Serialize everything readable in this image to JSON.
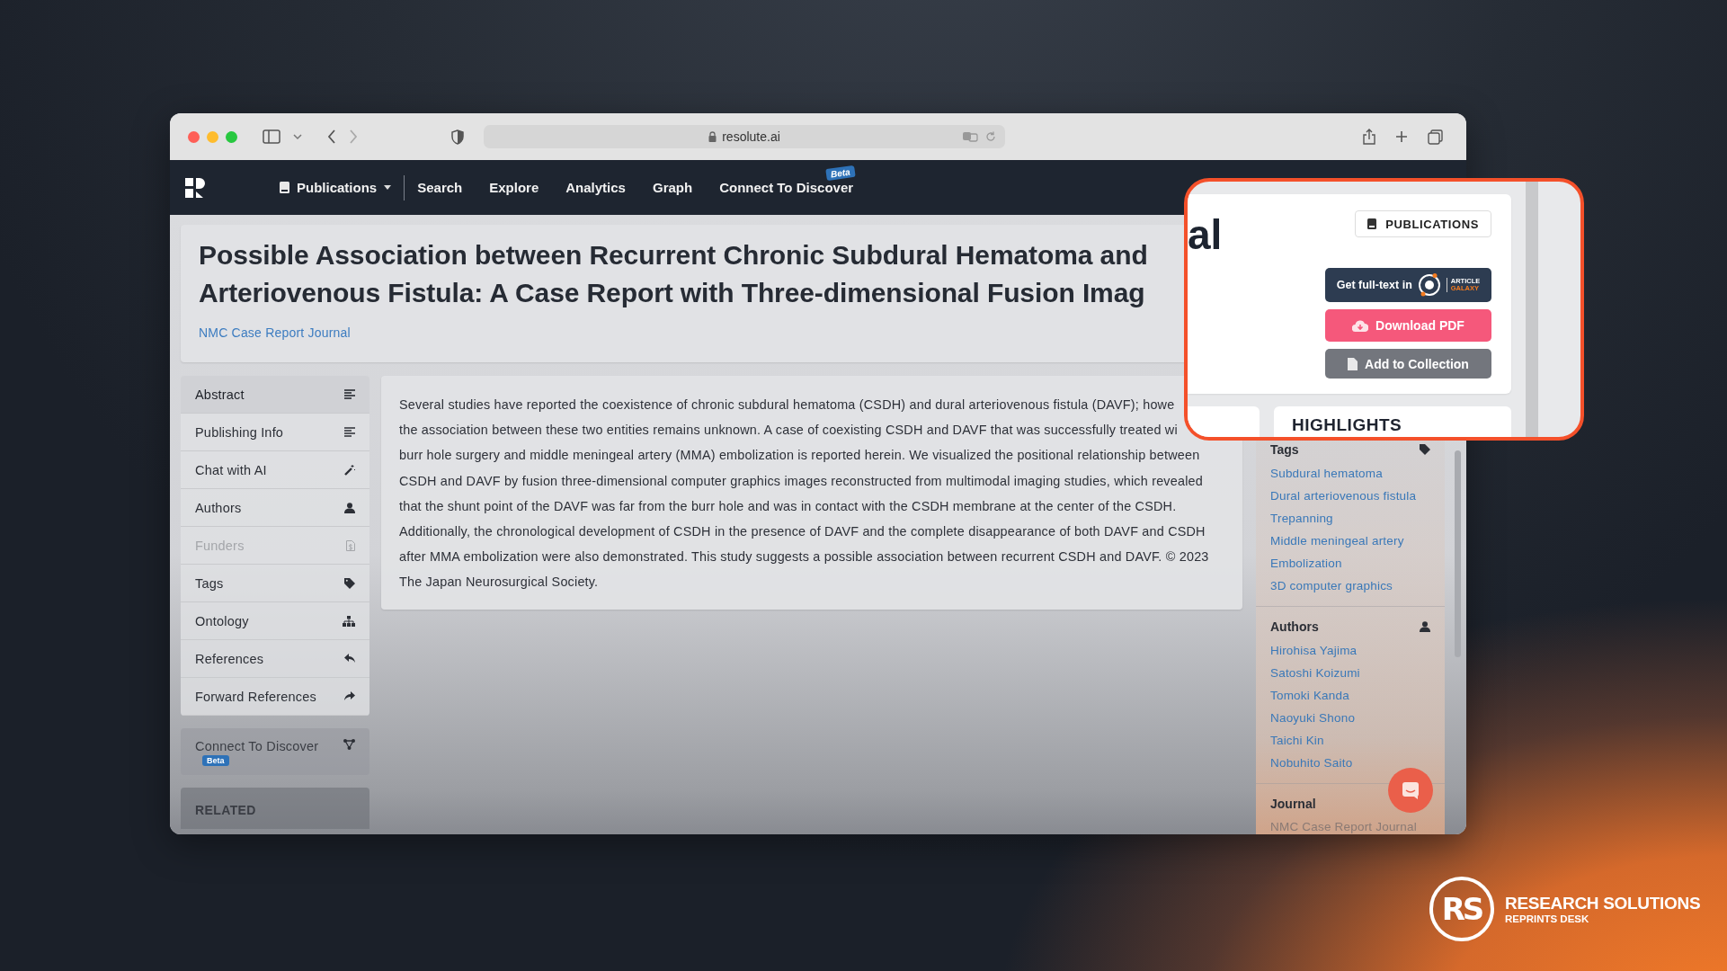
{
  "browser": {
    "url": "resolute.ai"
  },
  "nav": {
    "menu": "Publications",
    "links": [
      {
        "label": "Search"
      },
      {
        "label": "Explore"
      },
      {
        "label": "Analytics"
      },
      {
        "label": "Graph"
      },
      {
        "label": "Connect To Discover",
        "badge": "Beta"
      }
    ]
  },
  "article": {
    "title_lines": [
      "Possible Association between Recurrent Chronic Subdural Hematoma and",
      "Arteriovenous Fistula: A Case Report with Three-dimensional Fusion Imag"
    ],
    "journal": "NMC Case Report Journal"
  },
  "sidebar": {
    "items": [
      {
        "label": "Abstract",
        "selected": true,
        "disabled": false
      },
      {
        "label": "Publishing Info",
        "selected": false,
        "disabled": false
      },
      {
        "label": "Chat with AI",
        "selected": false,
        "disabled": false
      },
      {
        "label": "Authors",
        "selected": false,
        "disabled": false
      },
      {
        "label": "Funders",
        "selected": false,
        "disabled": true
      },
      {
        "label": "Tags",
        "selected": false,
        "disabled": false
      },
      {
        "label": "Ontology",
        "selected": false,
        "disabled": false
      },
      {
        "label": "References",
        "selected": false,
        "disabled": false
      },
      {
        "label": "Forward References",
        "selected": false,
        "disabled": false
      }
    ],
    "connect": {
      "label": "Connect To Discover",
      "badge": "Beta"
    },
    "related": "RELATED"
  },
  "abstract": {
    "lines": [
      "Several studies have reported the coexistence of chronic subdural hematoma (CSDH) and dural arteriovenous fistula (DAVF); howe",
      "the association between these two entities remains unknown. A case of coexisting CSDH and DAVF that was successfully treated wi",
      "burr hole surgery and middle meningeal artery (MMA) embolization is reported herein. We visualized the positional relationship between",
      "CSDH and DAVF by fusion three-dimensional computer graphics images reconstructed from multimodal imaging studies, which revealed",
      "that the shunt point of the DAVF was far from the burr hole and was in contact with the CSDH membrane at the center of the CSDH.",
      "Additionally, the chronological development of CSDH in the presence of DAVF and the complete disappearance of both DAVF and CSDH",
      "after MMA embolization were also demonstrated. This study suggests a possible association between recurrent CSDH and DAVF. © 2023",
      "The Japan Neurosurgical Society."
    ]
  },
  "side_panel": {
    "tags": {
      "title": "Tags",
      "items": [
        "Subdural hematoma",
        "Dural arteriovenous fistula",
        "Trepanning",
        "Middle meningeal artery",
        "Embolization",
        "3D computer graphics"
      ]
    },
    "authors": {
      "title": "Authors",
      "items": [
        "Hirohisa Yajima",
        "Satoshi Koizumi",
        "Tomoki Kanda",
        "Naoyuki Shono",
        "Taichi Kin",
        "Nobuhito Saito"
      ]
    },
    "journal": {
      "title": "Journal",
      "value": "NMC Case Report Journal"
    }
  },
  "callout": {
    "fragment": "al",
    "publications": "PUBLICATIONS",
    "fulltext": "Get full-text in",
    "galaxy": [
      "ARTICLE",
      "GALAXY"
    ],
    "download": "Download PDF",
    "collection": "Add to Collection",
    "highlights": "HIGHLIGHTS"
  },
  "brand": {
    "mark": "RS",
    "name": "RESEARCH SOLUTIONS",
    "sub": "REPRINTS DESK"
  }
}
